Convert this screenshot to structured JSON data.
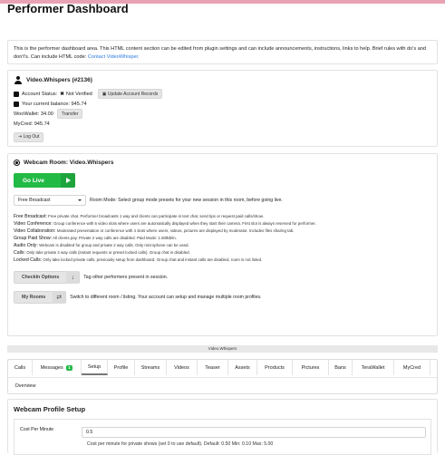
{
  "page": {
    "title": "Performer Dashboard"
  },
  "intro": {
    "text": "This is the performer dashboard area. This HTML content section can be edited from plugin settings and can include announcements, instructions, links to help. Brief rules with do's and don't's. Can include HTML code:",
    "link": "Contact VideoWhisper."
  },
  "account": {
    "name": "Video.Whispers (#2136)",
    "status_label": "Account Status:",
    "status_value": "Not Verified",
    "update_button": "Update Account Records",
    "balance": "Your current balance: 945.74",
    "woowallet": "WooWallet: 34.00",
    "transfer_button": "Transfer",
    "mycred": "MyCred: 945.74",
    "logout_button": "Log Out"
  },
  "webcam": {
    "title": "Webcam Room: Video.Whispers",
    "golive_button": "Go Live",
    "mode_select": "Free Broadcast",
    "mode_help": "Room Mode: Select group mode presets for your new session in this room, before going live.",
    "modes": [
      {
        "name": "Free Broadcast:",
        "desc": "Free private chat. Performer broadcasts 1 way and clients can participate in text chat, send tips or request paid calls/show."
      },
      {
        "name": "Video Conference:",
        "desc": "Group conference with 6 video slots where users are automatically displayed when they start their camera. First slot is always reserved for performer."
      },
      {
        "name": "Video Collaboration:",
        "desc": "Moderated presentation or conference with 4 slots where users, videos, pictures are displayed by moderator. Includes files sharing tab."
      },
      {
        "name": "Group Paid Show:",
        "desc": "All clients pay. Private 2 way calls are disabled. Paid Mode: 1.50tk$/m."
      },
      {
        "name": "Audio Only:",
        "desc": "Webcam is disabled for group and private 2 way calls. Only microphone can be used."
      },
      {
        "name": "Calls:",
        "desc": "Only take private 2 way calls (instant requests or preset locked calls). Group chat is disabled."
      },
      {
        "name": "Locked Calls:",
        "desc": "Only take locked private calls, previously setup from dashboard. Group chat and instant calls are disabled, room is not listed."
      }
    ],
    "checkin_button": "CheckIn Options",
    "checkin_help": "Tag other performers present in session.",
    "myrooms_button": "My Rooms",
    "myrooms_help": "Switch to different room / listing. Your account can setup and manage multiple room profiles."
  },
  "owner_bar": "Video.Whispers",
  "tabs": [
    {
      "label": "Calls"
    },
    {
      "label": "Messages",
      "badge": "1"
    },
    {
      "label": "Setup"
    },
    {
      "label": "Profile"
    },
    {
      "label": "Streams"
    },
    {
      "label": "Videos"
    },
    {
      "label": "Teaser"
    },
    {
      "label": "Assets"
    },
    {
      "label": "Products"
    },
    {
      "label": "Pictures"
    },
    {
      "label": "Bans"
    },
    {
      "label": "TeraWallet"
    },
    {
      "label": "MyCred"
    },
    {
      "label": "Overview"
    }
  ],
  "active_tab": "Setup",
  "profile_setup": {
    "title": "Webcam Profile Setup",
    "field_label": "Cost Per Minute",
    "field_value": "0.5",
    "field_help": "Cost per minute for private shows (set 0 to use default). Default: 0.50 Min: 0.10 Max: 5.00"
  },
  "colors": {
    "accent_green": "#21ba45",
    "link_blue": "#2a7be0",
    "top_bar": "#e8a2b3"
  },
  "icons": [
    "user-icon",
    "account-status-icon",
    "balance-icon",
    "webcam-icon",
    "play-icon",
    "dropdown-caret-icon",
    "arrow-down-icon",
    "swap-icon"
  ]
}
